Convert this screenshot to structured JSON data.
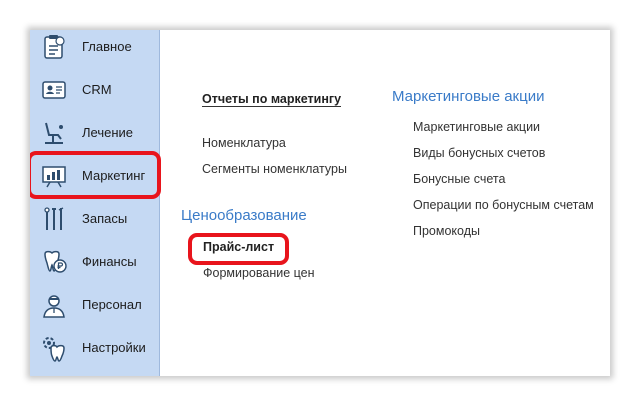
{
  "sidebar": {
    "items": [
      {
        "label": "Главное",
        "icon": "clipboard-tooth-icon"
      },
      {
        "label": "CRM",
        "icon": "contact-card-icon"
      },
      {
        "label": "Лечение",
        "icon": "dental-chair-icon"
      },
      {
        "label": "Маркетинг",
        "icon": "presentation-chart-icon"
      },
      {
        "label": "Запасы",
        "icon": "dental-tools-icon"
      },
      {
        "label": "Финансы",
        "icon": "tooth-ruble-icon"
      },
      {
        "label": "Персонал",
        "icon": "doctor-icon"
      },
      {
        "label": "Настройки",
        "icon": "tooth-gear-icon"
      }
    ],
    "active": "Маркетинг"
  },
  "content": {
    "reports_link": "Отчеты по маркетингу",
    "nomenclature_link": "Номенклатура",
    "segments_link": "Сегменты номенклатуры",
    "pricing_heading": "Ценообразование",
    "price_list_link": "Прайс-лист",
    "price_formation_link": "Формирование цен",
    "promo_heading": "Маркетинговые акции",
    "promo_links": [
      "Маркетинговые акции",
      "Виды бонусных счетов",
      "Бонусные счета",
      "Операции по бонусным счетам",
      "Промокоды"
    ]
  },
  "colors": {
    "sidebar_bg": "#c5d9f3",
    "heading": "#3a7bc8",
    "highlight": "#e8141c"
  }
}
